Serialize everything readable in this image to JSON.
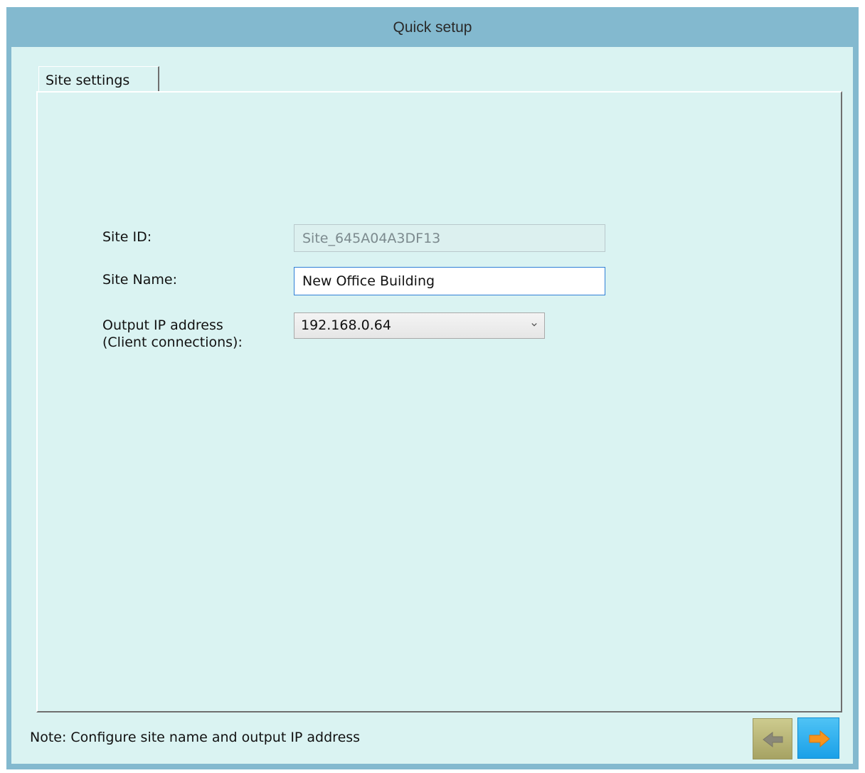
{
  "window": {
    "title": "Quick setup"
  },
  "tabs": [
    {
      "label": "Site settings",
      "active": true
    }
  ],
  "form": {
    "site_id": {
      "label": "Site ID:",
      "value": "Site_645A04A3DF13",
      "readonly": true
    },
    "site_name": {
      "label": "Site Name:",
      "value": "New Office Building"
    },
    "output_ip": {
      "label_line1": "Output IP address",
      "label_line2": "(Client connections):",
      "selected": "192.168.0.64"
    }
  },
  "footer": {
    "note": "Note: Configure site name and output IP address"
  },
  "nav": {
    "back_icon": "arrow-left-icon",
    "back_enabled": false,
    "next_icon": "arrow-right-icon",
    "next_enabled": true
  },
  "colors": {
    "titlebar": "#83b9cf",
    "client_background": "#daf3f2",
    "focus_border": "#2f7fd6",
    "next_button": "#1aa0e8",
    "next_arrow": "#f7941d",
    "back_button_disabled": "#b8b478"
  }
}
